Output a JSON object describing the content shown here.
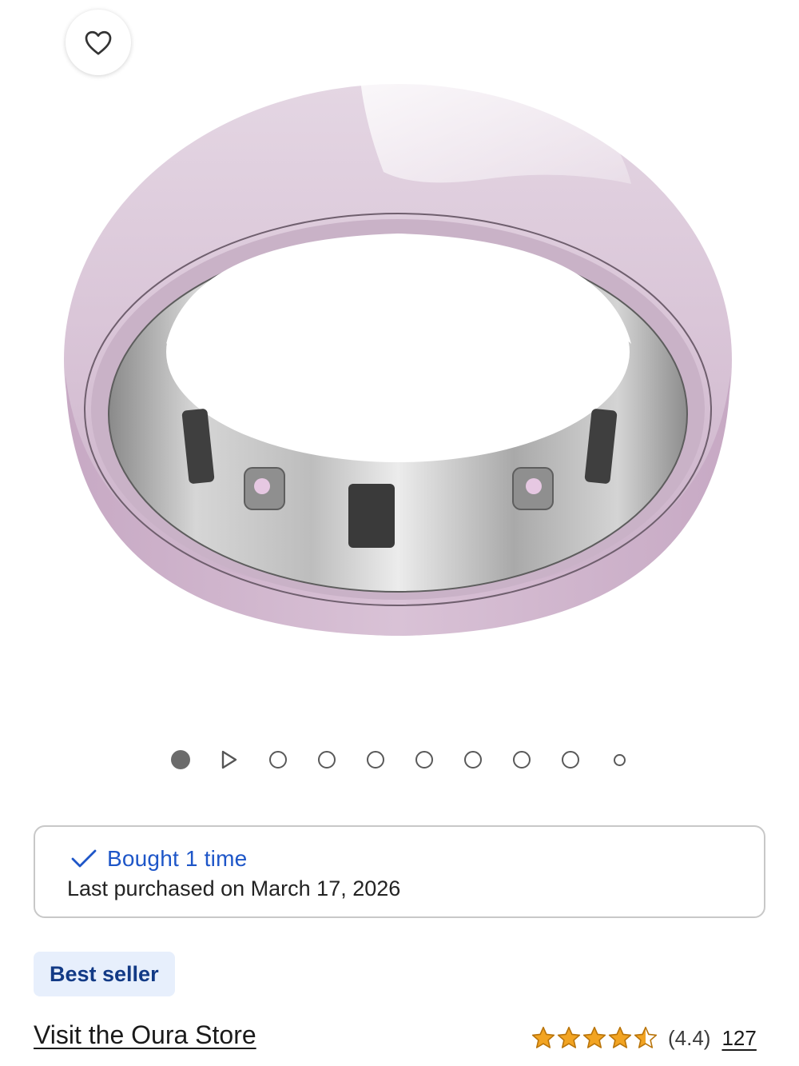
{
  "product": {
    "image_alt": "Oura Ring in pink ceramic",
    "ring_color": "#d9c4d6",
    "wishlist_icon": "heart-outline-icon"
  },
  "gallery": {
    "total_items": 10,
    "active_index": 0,
    "items": [
      "image",
      "video",
      "image",
      "image",
      "image",
      "image",
      "image",
      "image",
      "image",
      "image"
    ]
  },
  "purchase_history": {
    "icon": "checkmark-icon",
    "bought_label": "Bought 1 time",
    "last_purchased": "Last purchased on March 17, 2026"
  },
  "badge": {
    "label": "Best seller",
    "bg_color": "#e7effc",
    "text_color": "#123a86"
  },
  "store": {
    "link_text": "Visit the Oura Store"
  },
  "rating": {
    "stars": 4.4,
    "value_text": "(4.4)",
    "count_text": "127",
    "star_color": "#f2a422"
  }
}
